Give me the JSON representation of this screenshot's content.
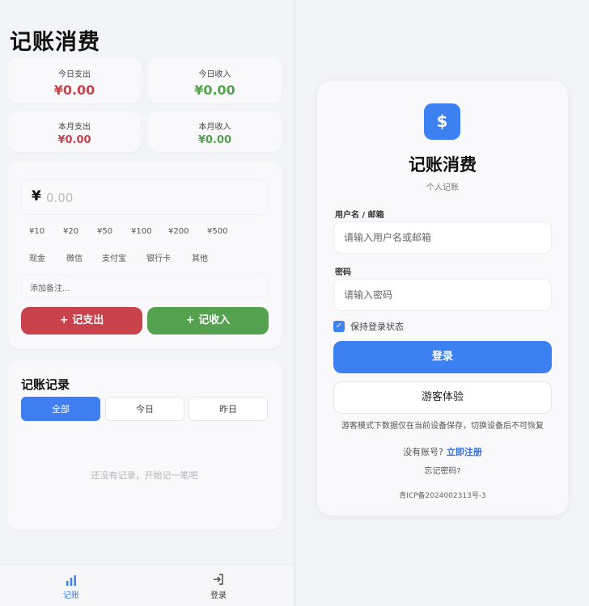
{
  "left": {
    "title": "记账消费",
    "stats": {
      "today_expense": {
        "label": "今日支出",
        "value": "¥0.00"
      },
      "today_income": {
        "label": "今日收入",
        "value": "¥0.00"
      },
      "month_expense": {
        "label": "本月支出",
        "value": "¥0.00"
      },
      "month_income": {
        "label": "本月收入",
        "value": "¥0.00"
      }
    },
    "amount": {
      "currency": "¥",
      "placeholder": "0.00"
    },
    "quick_amounts": [
      "¥10",
      "¥20",
      "¥50",
      "¥100",
      "¥200",
      "¥500"
    ],
    "payment_methods": [
      "现金",
      "微信",
      "支付宝",
      "银行卡",
      "其他"
    ],
    "note_placeholder": "添加备注...",
    "expense_button": "+ 记支出",
    "income_button": "+ 记收入",
    "records": {
      "title": "记账记录",
      "tabs": [
        "全部",
        "今日",
        "昨日"
      ],
      "active_tab": "全部",
      "empty_text": "还没有记录，开始记一笔吧"
    },
    "nav": [
      {
        "label": "记账",
        "icon": "bar-chart-icon",
        "active": true
      },
      {
        "label": "登录",
        "icon": "login-icon",
        "active": false
      }
    ]
  },
  "right": {
    "logo_symbol": "$",
    "title": "记账消费",
    "subtitle": "个人记账",
    "username_label": "用户名 / 邮箱",
    "username_placeholder": "请输入用户名或邮箱",
    "password_label": "密码",
    "password_placeholder": "请输入密码",
    "remember_label": "保持登录状态",
    "login_button": "登录",
    "guest_button": "游客体验",
    "guest_note": "游客模式下数据仅在当前设备保存，切换设备后不可恢复",
    "register_prompt": "没有账号?",
    "register_link": "立即注册",
    "forgot": "忘记密码?",
    "icp": "青ICP备2024002313号-3"
  },
  "colors": {
    "expense": "#c9434c",
    "income": "#54a14f",
    "primary": "#3d80f2"
  }
}
